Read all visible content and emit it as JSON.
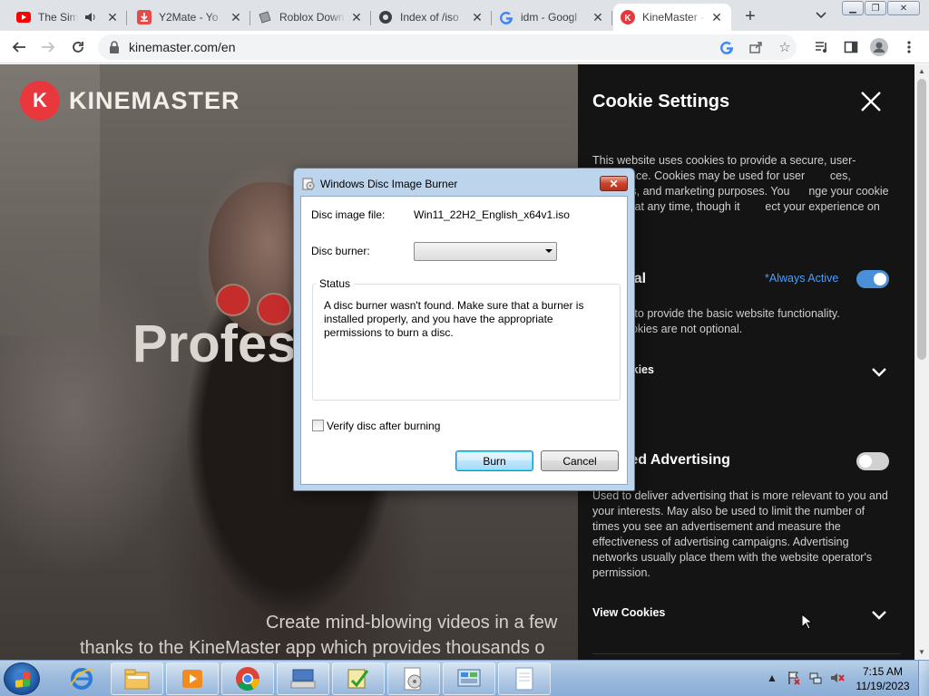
{
  "browser": {
    "tabs": [
      {
        "title": "The Simp",
        "favicon": "youtube-icon",
        "audio": true
      },
      {
        "title": "Y2Mate - Yo",
        "favicon": "y2mate-icon"
      },
      {
        "title": "Roblox Down",
        "favicon": "roblox-download-icon"
      },
      {
        "title": "Index of /iso",
        "favicon": "index-icon"
      },
      {
        "title": "idm - Googl",
        "favicon": "google-icon"
      },
      {
        "title": "KineMaster -",
        "favicon": "kinemaster-icon",
        "active": true
      }
    ],
    "url": "kinemaster.com/en"
  },
  "page": {
    "logo_text": "KINEMASTER",
    "logo_mark": "K",
    "hero_title": "Profes",
    "hero_sub_line1": "Create mind-blowing videos in a few",
    "hero_sub_line2": "thanks to the KineMaster app which provides thousands o"
  },
  "cookie_panel": {
    "title": "Cookie Settings",
    "intro": "This website uses cookies to provide a secure, user-      experience. Cookies may be used for user        ces, analytics, and marketing purposes. You      nge your cookie settings at any time, though it        ect your experience on this site.",
    "essential_title": "tial",
    "always_active": "*Always Active",
    "essential_desc": "d to provide the basic website functionality.            ookies are not optional.",
    "view_cookies_1": "okies",
    "targeted_title": "ted Advertising",
    "targeted_desc": "Used to deliver advertising that is more relevant to you and your interests. May also be used to limit the number of times you see an advertisement and measure the effectiveness of advertising campaigns. Advertising networks usually place them with the website operator's permission.",
    "view_cookies_2": "View Cookies",
    "essential_on": true,
    "targeted_on": false,
    "accent": "#4a90d9"
  },
  "dialog": {
    "title": "Windows Disc Image Burner",
    "file_label": "Disc image file:",
    "file_value": "Win11_22H2_English_x64v1.iso",
    "burner_label": "Disc burner:",
    "burner_value": "",
    "status_label": "Status",
    "status_text": "A disc burner wasn't found. Make sure that a burner is installed properly, and you have the appropriate permissions to burn a disc.",
    "verify_label": "Verify disc after burning",
    "verify_checked": false,
    "burn_label": "Burn",
    "cancel_label": "Cancel"
  },
  "taskbar": {
    "items": [
      "internet-explorer-icon",
      "file-explorer-icon",
      "media-player-icon",
      "chrome-icon",
      "keyboard-app-icon",
      "checklist-app-icon",
      "disc-burner-icon",
      "control-panel-icon",
      "notepad-icon"
    ],
    "time": "7:15 AM",
    "date": "11/19/2023"
  }
}
